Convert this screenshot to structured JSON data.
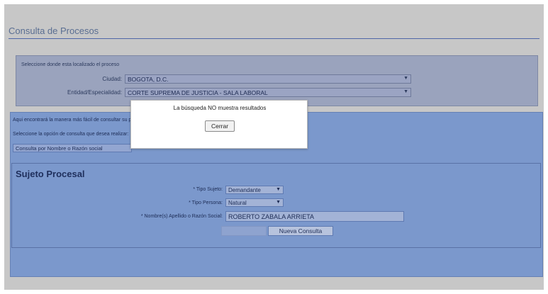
{
  "page": {
    "title": "Consulta de Procesos"
  },
  "location": {
    "heading": "Seleccione donde esta localizado el proceso",
    "ciudad_label": "Ciudad:",
    "ciudad_value": "BOGOTA, D.C.",
    "entidad_label": "Entidad/Especialidad:",
    "entidad_value": "CORTE SUPREMA DE JUSTICIA - SALA LABORAL"
  },
  "consulta": {
    "text1": "Aqui encontrará la manera más fácil de consultar su proceso.",
    "text2": "Seleccione la opción de consulta que desea realizar:",
    "type_value": "Consulta por Nombre o Razón social"
  },
  "sujeto": {
    "title": "Sujeto Procesal",
    "tipo_sujeto_label": "* Tipo Sujeto:",
    "tipo_sujeto_value": "Demandante",
    "tipo_persona_label": "* Tipo Persona:",
    "tipo_persona_value": "Natural",
    "nombre_label": "* Nombre(s) Apellido o Razón Social:",
    "nombre_value": "ROBERTO ZABALA ARRIETA",
    "nueva_label": "Nueva Consulta"
  },
  "dialog": {
    "message": "La búsqueda NO muestra resultados",
    "close_label": "Cerrar"
  },
  "icons": {
    "dropdown": "chevron-down-icon"
  }
}
